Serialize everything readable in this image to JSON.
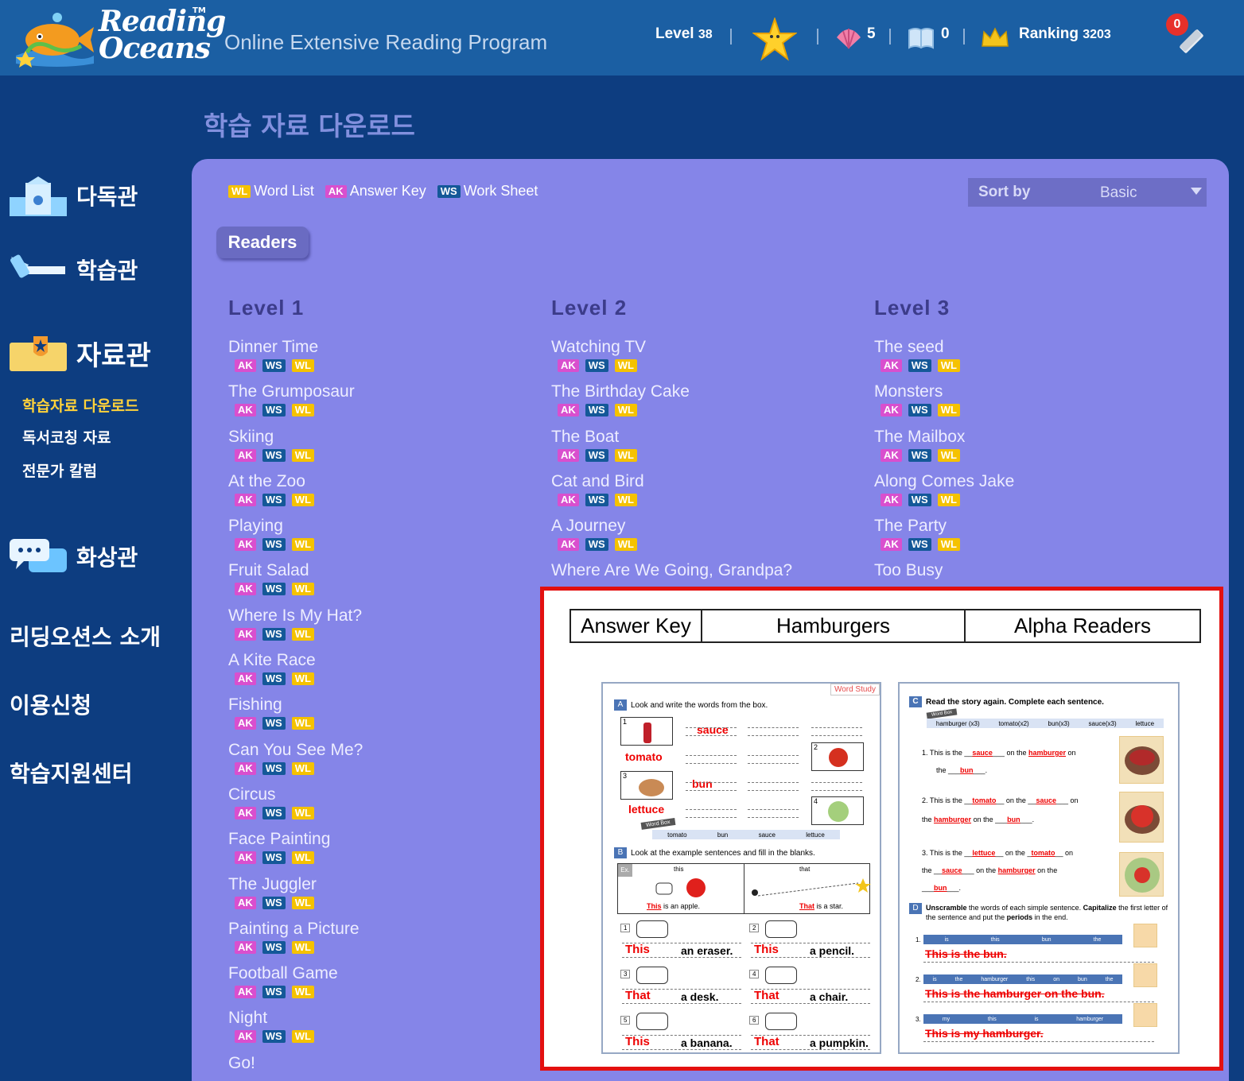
{
  "header": {
    "logo_text_1": "Reading",
    "logo_text_2": "Oceans",
    "logo_tm": "TM",
    "program_title": "Online Extensive Reading Program",
    "level_label": "Level",
    "level_value": "38",
    "shells": "5",
    "books": "0",
    "ranking_label": "Ranking",
    "ranking_value": "3203",
    "notifications": "0"
  },
  "page_heading": "학습 자료 다운로드",
  "sidebar": {
    "menu_1": "다독관",
    "menu_2": "학습관",
    "menu_3": "자료관",
    "sub_1": "학습자료 다운로드",
    "sub_2": "독서코칭 자료",
    "sub_3": "전문가 칼럼",
    "menu_4": "화상관",
    "menu_5": "리딩오션스 소개",
    "menu_6": "이용신청",
    "menu_7": "학습지원센터"
  },
  "legend": {
    "wl_tag": "WL",
    "wl_label": "Word List",
    "ak_tag": "AK",
    "ak_label": "Answer Key",
    "ws_tag": "WS",
    "ws_label": "Work Sheet"
  },
  "sort": {
    "label": "Sort by",
    "value": "Basic"
  },
  "tab": "Readers",
  "badges": {
    "ak": "AK",
    "ws": "WS",
    "wl": "WL"
  },
  "levels": [
    {
      "name": "Level  1",
      "books": [
        "Dinner Time",
        "The Grumposaur",
        "Skiing",
        "At the Zoo",
        "Playing",
        "Fruit Salad",
        "Where Is My Hat?",
        "A Kite Race",
        "Fishing",
        "Can You See Me?",
        "Circus",
        "Face Painting",
        "The Juggler",
        "Painting a Picture",
        "Football Game",
        "Night",
        "Go!"
      ]
    },
    {
      "name": "Level  2",
      "books": [
        "Watching TV",
        "The Birthday Cake",
        "The Boat",
        "Cat and Bird",
        "A Journey",
        "Where Are We Going, Grandpa?"
      ]
    },
    {
      "name": "Level  3",
      "books": [
        "The seed",
        "Monsters",
        "The Mailbox",
        "Along Comes Jake",
        "The Party",
        "Too Busy"
      ]
    }
  ],
  "preview": {
    "col_1": "Answer Key",
    "col_2": "Hamburgers",
    "col_3": "Alpha Readers",
    "left_sheet": {
      "badge": "Word Study",
      "secA_tag": "A",
      "secA": "Look and write the words from the box.",
      "answers_A": [
        "sauce",
        "tomato",
        "bun",
        "lettuce"
      ],
      "wordbox_label": "Word Box",
      "wordbox": [
        "tomato",
        "bun",
        "sauce",
        "lettuce"
      ],
      "secB_tag": "B",
      "secB": "Look at the example sentences and fill in the blanks.",
      "ex_tag": "Ex.",
      "ex_this": "this",
      "ex_that": "that",
      "ex_1a": "This",
      "ex_1b": " is an apple.",
      "ex_2a": "That",
      "ex_2b": " is a star.",
      "rows": [
        {
          "n": "1",
          "a": "This",
          "b": "an eraser."
        },
        {
          "n": "2",
          "a": "This",
          "b": "a pencil."
        },
        {
          "n": "3",
          "a": "That",
          "b": "a desk."
        },
        {
          "n": "4",
          "a": "That",
          "b": "a chair."
        },
        {
          "n": "5",
          "a": "This",
          "b": "a banana."
        },
        {
          "n": "6",
          "a": "That",
          "b": "a pumpkin."
        }
      ]
    },
    "right_sheet": {
      "secC_tag": "C",
      "secC": "Read the story again. Complete each sentence.",
      "wordbox_label": "Word Box",
      "wordbox": [
        "hamburger (x3)",
        "tomato(x2)",
        "bun(x3)",
        "sauce(x3)",
        "lettuce"
      ],
      "s1_p1": "1. This is the",
      "s1_a1": "sauce",
      "s1_p2": "on the",
      "s1_a2": "hamburger",
      "s1_p3": "on",
      "s1_p4": "the",
      "s1_a3": "bun",
      "s2_p1": "2. This is the",
      "s2_a1": "tomato",
      "s2_p2": "on the",
      "s2_a2": "sauce",
      "s2_p3": "on",
      "s2_p4": "the",
      "s2_a3": "hamburger",
      "s2_p5": "on the",
      "s2_a4": "bun",
      "s3_p1": "3. This is the",
      "s3_a1": "lettuce",
      "s3_p2": "on the",
      "s3_a2": "tomato",
      "s3_p3": "on",
      "s3_p4": "the",
      "s3_a3": "sauce",
      "s3_p5": "on the",
      "s3_a4": "hamburger",
      "s3_p6": "on the",
      "s3_a5": "bun",
      "secD_tag": "D",
      "secD_1": "Unscramble",
      "secD_2": " the words of each simple sentence. ",
      "secD_3": "Capitalize",
      "secD_4": " the first letter of the sentence and put the ",
      "secD_5": "periods",
      "secD_6": " in the end.",
      "d1_words": [
        "is",
        "this",
        "bun",
        "the"
      ],
      "d1_answer": "This is the bun.",
      "d2_words": [
        "is",
        "the",
        "hamburger",
        "this",
        "on",
        "bun",
        "the"
      ],
      "d2_answer": "This is the hamburger on the bun.",
      "d3_words": [
        "my",
        "this",
        "is",
        "hamburger"
      ],
      "d3_answer": "This is my  hamburger."
    }
  }
}
